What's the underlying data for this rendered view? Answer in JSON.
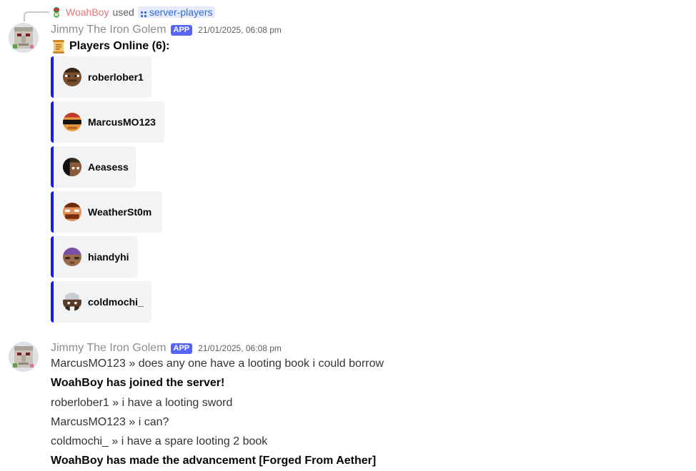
{
  "reply": {
    "username": "WoahBoy",
    "used_text": "used",
    "command": "server-players"
  },
  "message1": {
    "author": "Jimmy The Iron Golem",
    "tag": "APP",
    "timestamp": "21/01/2025, 06:08 pm",
    "title": "Players Online (6):",
    "players": [
      {
        "name": "roberlober1"
      },
      {
        "name": "MarcusMO123"
      },
      {
        "name": "Aeasess"
      },
      {
        "name": "WeatherSt0m"
      },
      {
        "name": "hiandyhi"
      },
      {
        "name": "coldmochi_"
      }
    ]
  },
  "message2": {
    "author": "Jimmy The Iron Golem",
    "tag": "APP",
    "timestamp": "21/01/2025, 06:08 pm",
    "lines": [
      {
        "text": "MarcusMO123 » does any one have a looting book i could borrow"
      },
      {
        "text": "WoahBoy has joined the server!"
      },
      {
        "text": "roberlober1 » i have a looting sword"
      },
      {
        "text": "MarcusMO123 » i can?"
      },
      {
        "text": "coldmochi_ » i have a spare looting 2 book"
      },
      {
        "text": "WoahBoy has made the advancement [Forged From Aether]"
      }
    ]
  },
  "colors": {
    "embed_border": "#1d1dd8",
    "app_tag": "#5865f2",
    "reply_username": "#e5737a",
    "command_link": "#2e6bd8"
  }
}
